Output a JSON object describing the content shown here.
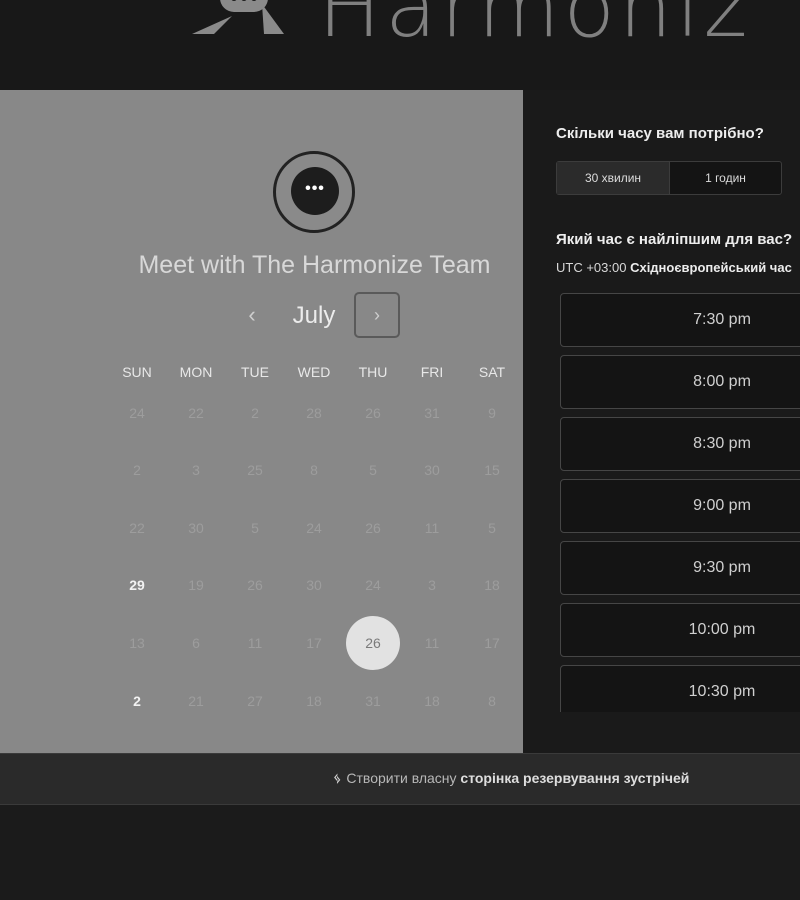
{
  "header": {
    "brand_text": "Harmoniz"
  },
  "calendar": {
    "title": "Meet with The Harmonize Team",
    "month": "July",
    "prev_label": "‹",
    "next_label": "›",
    "day_headers": [
      "SUN",
      "MON",
      "TUE",
      "WED",
      "THU",
      "FRI",
      "SAT"
    ],
    "weeks": [
      [
        "24",
        "22",
        "2",
        "28",
        "26",
        "31",
        "9"
      ],
      [
        "2",
        "3",
        "25",
        "8",
        "5",
        "30",
        "15"
      ],
      [
        "22",
        "30",
        "5",
        "24",
        "26",
        "11",
        "5"
      ],
      [
        "29",
        "19",
        "26",
        "30",
        "24",
        "3",
        "18"
      ],
      [
        "13",
        "6",
        "11",
        "17",
        "26",
        "11",
        "17"
      ],
      [
        "2",
        "21",
        "27",
        "18",
        "31",
        "18",
        "8"
      ]
    ],
    "selected_date": "26"
  },
  "booking": {
    "duration_question": "Скільки часу вам потрібно?",
    "durations": [
      "30 хвилин",
      "1 годин"
    ],
    "time_question": "Який час є найліпшим для вас?",
    "timezone_offset": "UTC +03:00",
    "timezone_name": "Східноєвропейський час",
    "time_slots": [
      "7:30 pm",
      "8:00 pm",
      "8:30 pm",
      "9:00 pm",
      "9:30 pm",
      "10:00 pm",
      "10:30 pm"
    ]
  },
  "footer": {
    "prefix": "Створити власну",
    "link": "сторінка резервування зустрічей"
  }
}
